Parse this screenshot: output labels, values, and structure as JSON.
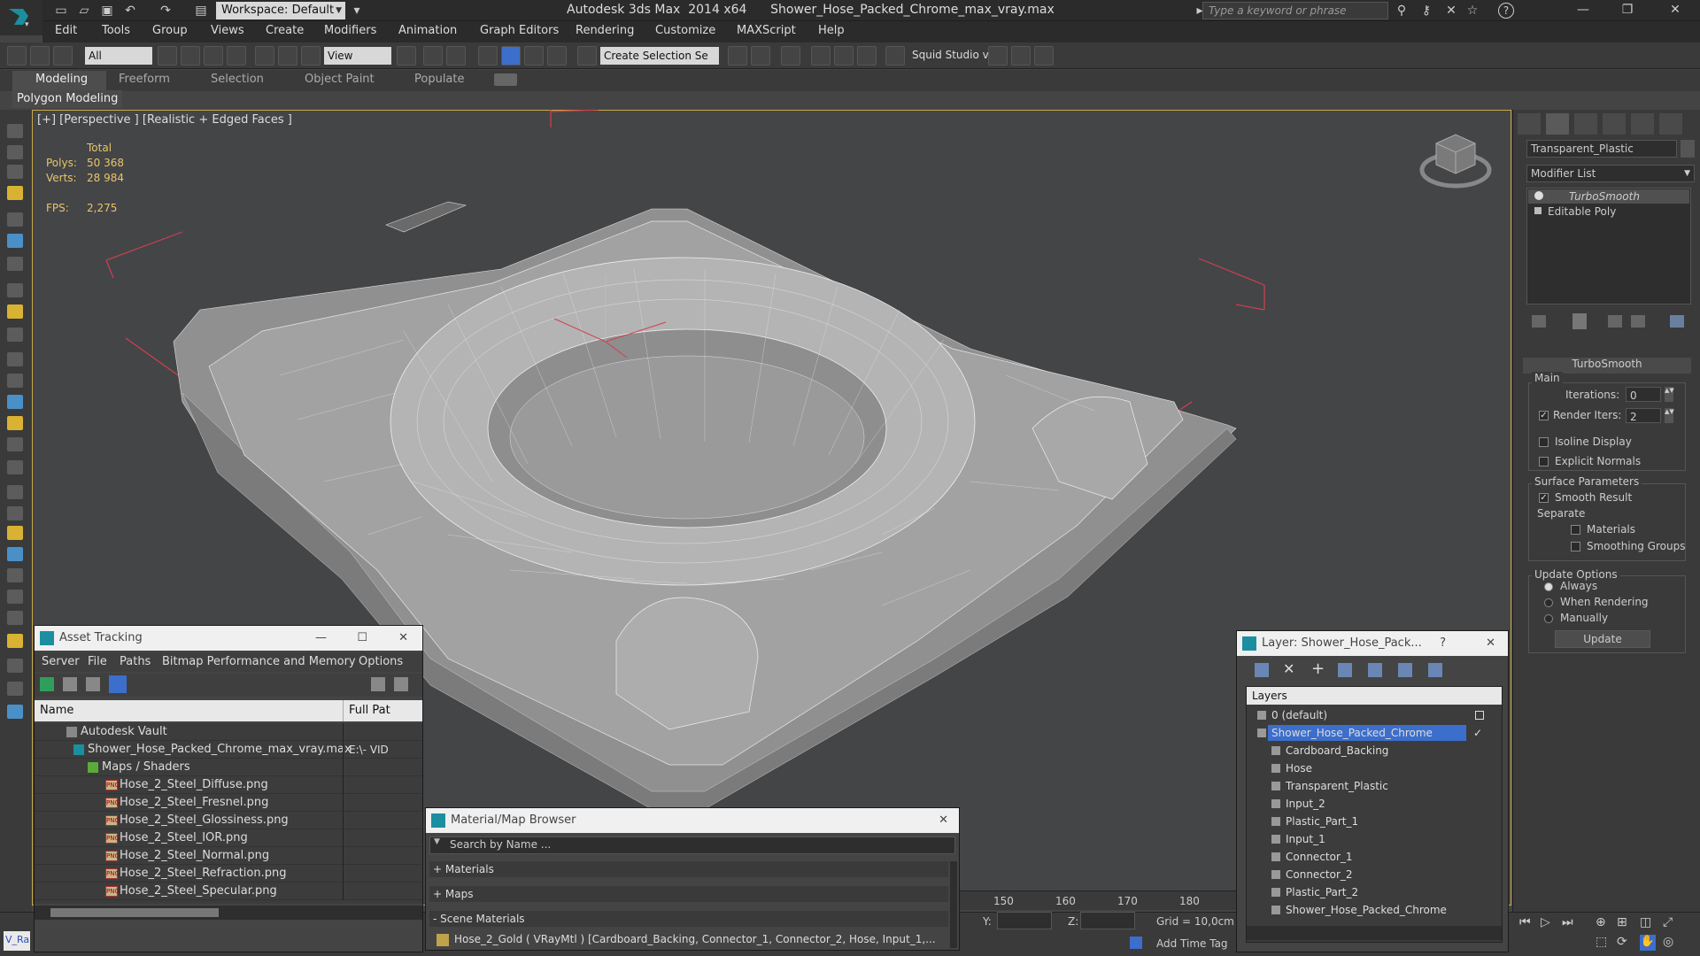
{
  "titlebar": {
    "workspace": "Workspace: Default",
    "title": "Autodesk 3ds Max  2014 x64      Shower_Hose_Packed_Chrome_max_vray.max",
    "search_placeholder": "Type a keyword or phrase",
    "help": "?"
  },
  "menu": [
    "Edit",
    "Tools",
    "Group",
    "Views",
    "Create",
    "Modifiers",
    "Animation",
    "Graph Editors",
    "Rendering",
    "Customize",
    "MAXScript",
    "Help"
  ],
  "toolbar": {
    "selection_filter": "All",
    "ref_coord": "View",
    "named_selection": "Create Selection Se",
    "squid_label": "Squid Studio v"
  },
  "ribbon": {
    "tabs": [
      "Modeling",
      "Freeform",
      "Selection",
      "Object Paint",
      "Populate"
    ],
    "panel_label": "Polygon Modeling"
  },
  "viewport": {
    "label": "[+] [Perspective ] [Realistic + Edged Faces ]",
    "stats_header": "Total",
    "polys_label": "Polys:",
    "polys_value": "50 368",
    "verts_label": "Verts:",
    "verts_value": "28 984",
    "fps_label": "FPS:",
    "fps_value": "2,275"
  },
  "command_panel": {
    "object_name": "Transparent_Plastic",
    "modifier_list": "Modifier List",
    "stack": [
      "TurboSmooth",
      "Editable Poly"
    ],
    "rollout_title": "TurboSmooth",
    "main_label": "Main",
    "iterations_label": "Iterations:",
    "iterations_value": "0",
    "render_iters_label": "Render Iters:",
    "render_iters_value": "2",
    "isoline_label": "Isoline Display",
    "explicit_normals_label": "Explicit Normals",
    "surface_params_label": "Surface Parameters",
    "smooth_result_label": "Smooth Result",
    "separate_label": "Separate",
    "materials_label": "Materials",
    "smoothing_groups_label": "Smoothing Groups",
    "update_options_label": "Update Options",
    "always_label": "Always",
    "when_rendering_label": "When Rendering",
    "manually_label": "Manually",
    "update_button": "Update"
  },
  "asset_tracking": {
    "title": "Asset Tracking",
    "menu": [
      "Server",
      "File",
      "Paths",
      "Bitmap Performance and Memory",
      "Options"
    ],
    "col_name": "Name",
    "col_path": "Full Pat",
    "rows": [
      {
        "name": "Autodesk Vault",
        "path": ""
      },
      {
        "name": "Shower_Hose_Packed_Chrome_max_vray.max",
        "path": "E:\\- VID"
      },
      {
        "name": "Maps / Shaders",
        "path": ""
      },
      {
        "name": "Hose_2_Steel_Diffuse.png",
        "path": ""
      },
      {
        "name": "Hose_2_Steel_Fresnel.png",
        "path": ""
      },
      {
        "name": "Hose_2_Steel_Glossiness.png",
        "path": ""
      },
      {
        "name": "Hose_2_Steel_IOR.png",
        "path": ""
      },
      {
        "name": "Hose_2_Steel_Normal.png",
        "path": ""
      },
      {
        "name": "Hose_2_Steel_Refraction.png",
        "path": ""
      },
      {
        "name": "Hose_2_Steel_Specular.png",
        "path": ""
      }
    ],
    "file_badge": "PNG"
  },
  "material_browser": {
    "title": "Material/Map Browser",
    "search_placeholder": "Search by Name ...",
    "sections": [
      "+ Materials",
      "+ Maps",
      "- Scene Materials"
    ],
    "scene_material": "Hose_2_Gold ( VRayMtl ) [Cardboard_Backing, Connector_1, Connector_2, Hose, Input_1,..."
  },
  "layer_window": {
    "title": "Layer: Shower_Hose_Pack...",
    "help": "?",
    "header": "Layers",
    "layers": [
      "0 (default)",
      "Shower_Hose_Packed_Chrome",
      "Cardboard_Backing",
      "Hose",
      "Transparent_Plastic",
      "Input_2",
      "Plastic_Part_1",
      "Input_1",
      "Connector_1",
      "Connector_2",
      "Plastic_Part_2",
      "Shower_Hose_Packed_Chrome"
    ]
  },
  "timeline": {
    "ticks": [
      "150",
      "160",
      "170",
      "180"
    ]
  },
  "status": {
    "y_label": "Y:",
    "z_label": "Z:",
    "grid": "Grid = 10,0cm",
    "add_time_tag": "Add Time Tag",
    "maxscript_prefix": "V_Ra"
  },
  "colors": {
    "viewport_bg": "#444547",
    "panel_bg": "#3a3a3a",
    "selection_blue": "#3c6ecc",
    "stat_yellow": "#e9c46a",
    "bbox_red": "#d04050"
  }
}
